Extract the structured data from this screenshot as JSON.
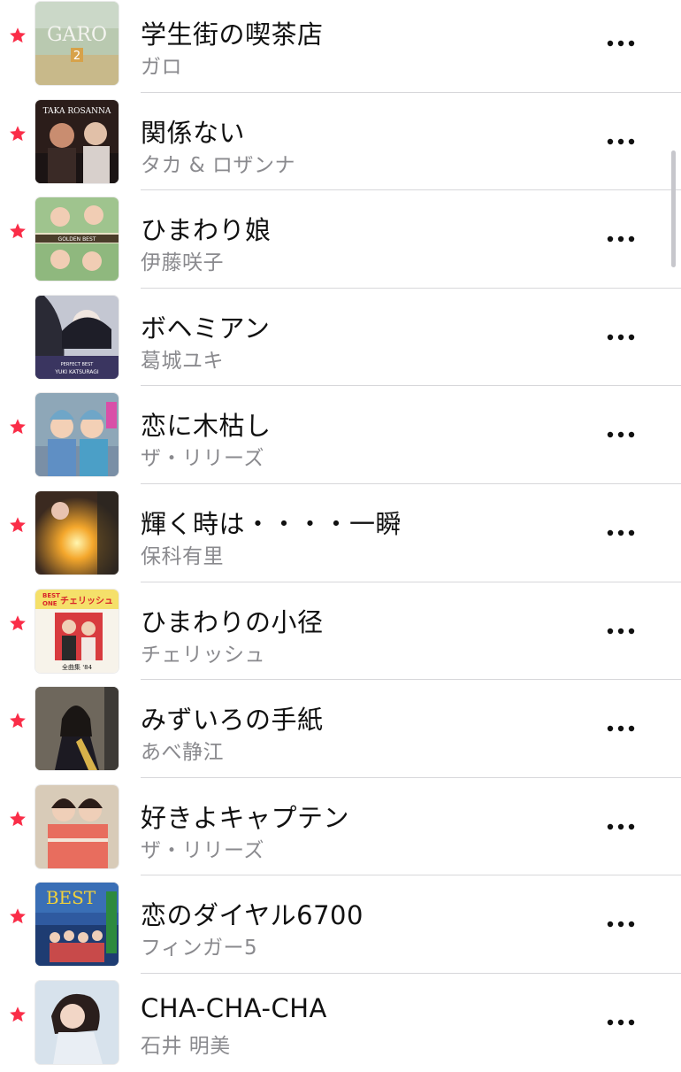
{
  "colors": {
    "favorite_star": "#fa2d48",
    "title_text": "#111111",
    "artist_text": "#8a8a8e",
    "divider": "#d7d7da"
  },
  "icons": {
    "favorite": "star-icon",
    "more": "ellipsis-icon"
  },
  "songs": [
    {
      "title": "学生街の喫茶店",
      "artist": "ガロ",
      "favorite": true,
      "art_text": "GARO 2"
    },
    {
      "title": "関係ない",
      "artist": "タカ & ロザンナ",
      "favorite": true,
      "art_text": "TAKA ROSANNA"
    },
    {
      "title": "ひまわり娘",
      "artist": "伊藤咲子",
      "favorite": true,
      "art_text": "GOLDEN BEST"
    },
    {
      "title": "ボヘミアン",
      "artist": "葛城ユキ",
      "favorite": false,
      "art_text": "PERFECT BEST YUKI KATSURAGI"
    },
    {
      "title": "恋に木枯し",
      "artist": "ザ・リリーズ",
      "favorite": true,
      "art_text": ""
    },
    {
      "title": "輝く時は・・・・一瞬",
      "artist": "保科有里",
      "favorite": true,
      "art_text": ""
    },
    {
      "title": "ひまわりの小径",
      "artist": "チェリッシュ",
      "favorite": true,
      "art_text": "BEST ONE チェリッシュ 全曲集 '84"
    },
    {
      "title": "みずいろの手紙",
      "artist": "あべ静江",
      "favorite": true,
      "art_text": ""
    },
    {
      "title": "好きよキャプテン",
      "artist": "ザ・リリーズ",
      "favorite": true,
      "art_text": ""
    },
    {
      "title": "恋のダイヤル6700",
      "artist": "フィンガー5",
      "favorite": true,
      "art_text": "BEST"
    },
    {
      "title": "CHA-CHA-CHA",
      "artist": "石井 明美",
      "favorite": true,
      "art_text": ""
    }
  ]
}
